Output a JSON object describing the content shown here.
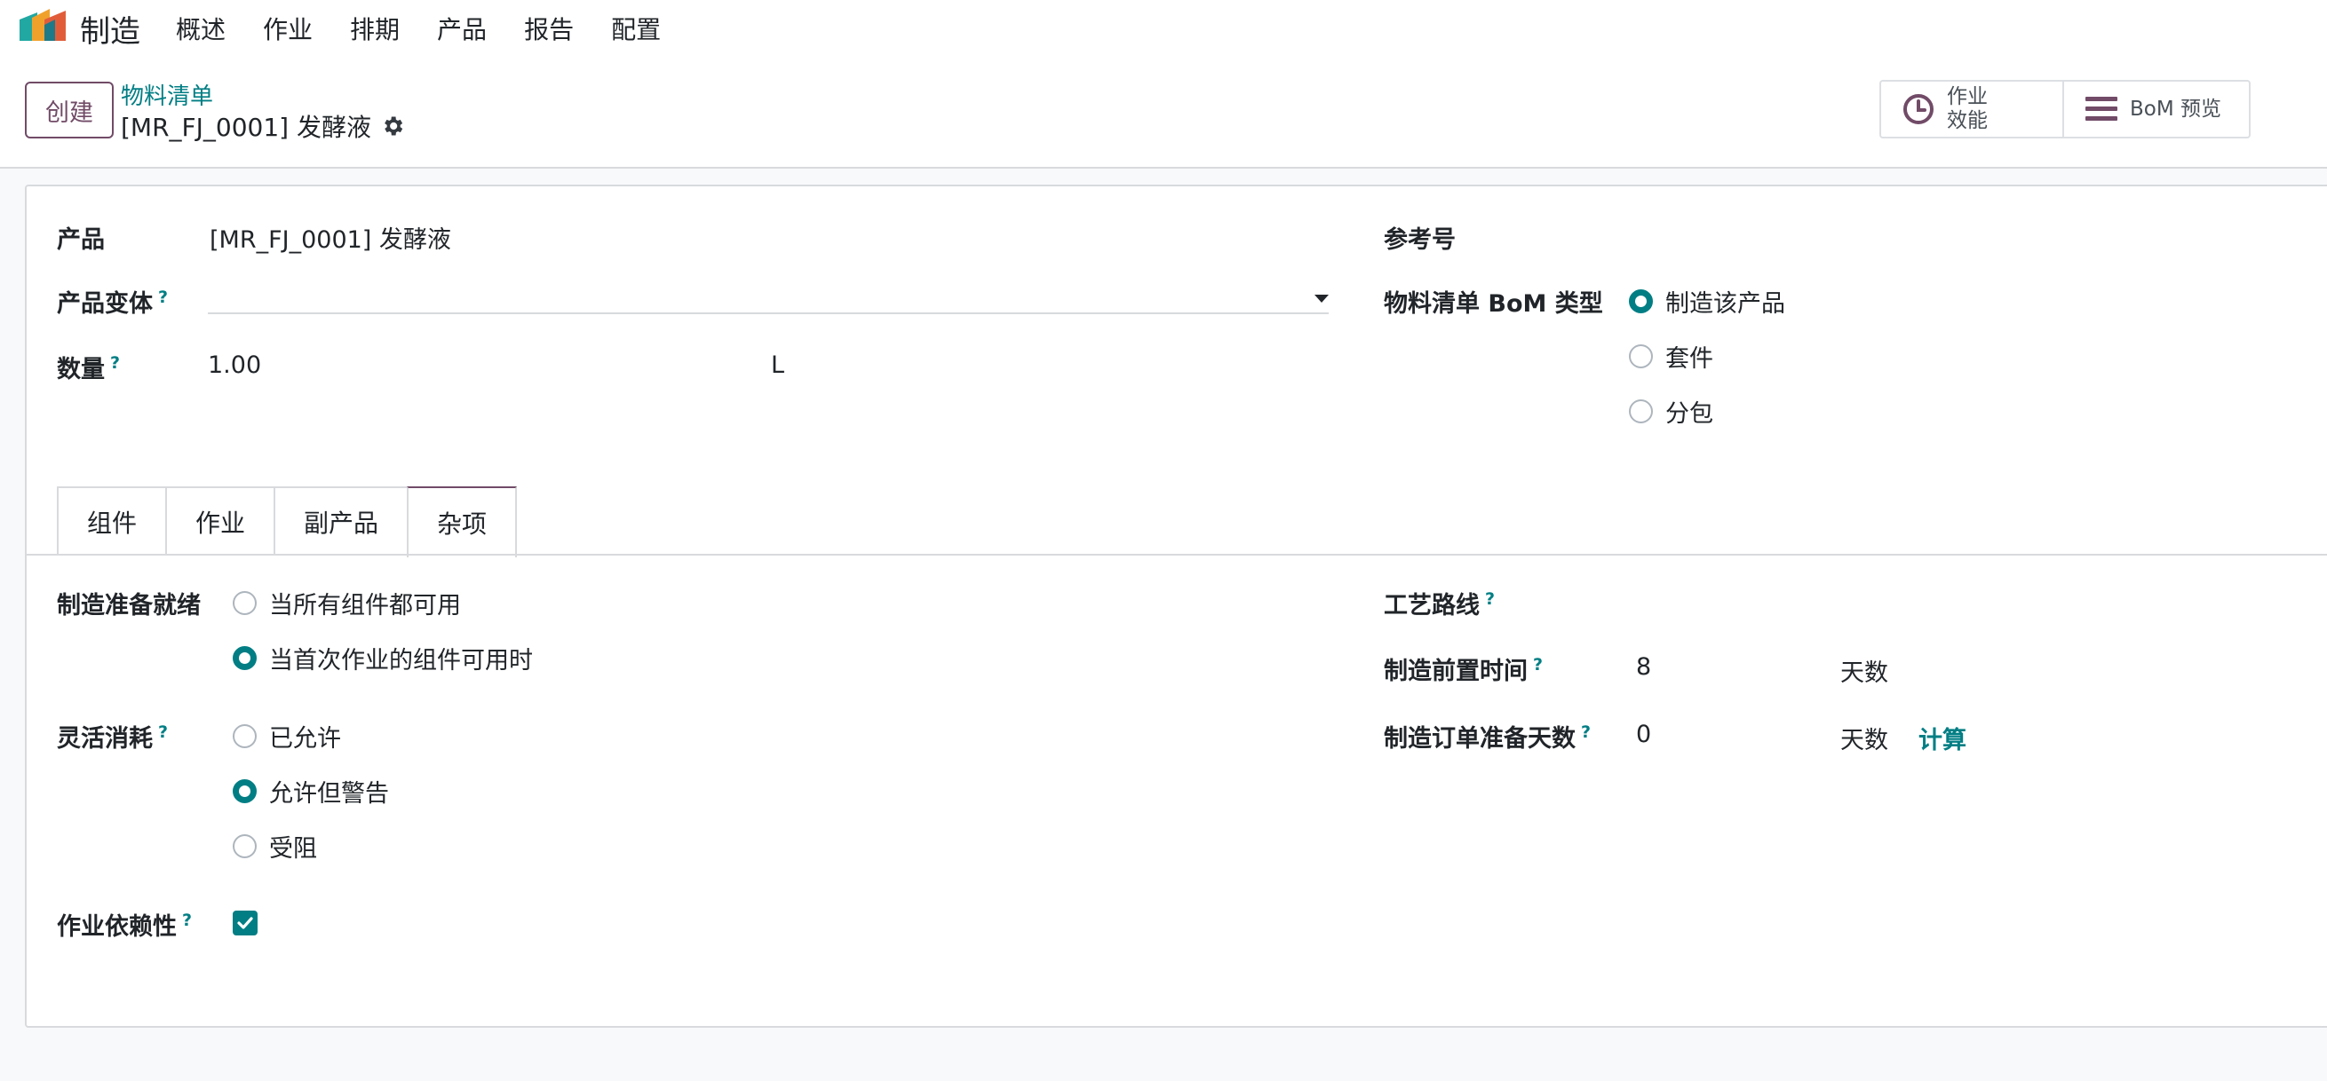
{
  "app": {
    "name": "制造"
  },
  "menu": [
    "概述",
    "作业",
    "排期",
    "产品",
    "报告",
    "配置"
  ],
  "control": {
    "create_label": "创建",
    "breadcrumb": "物料清单",
    "record_title": "[MR_FJ_0001] 发酵液",
    "smart_buttons": {
      "efficiency_line1": "作业",
      "efficiency_line2": "效能",
      "bom_preview": "BoM 预览"
    }
  },
  "form": {
    "product_label": "产品",
    "product_value": "[MR_FJ_0001] 发酵液",
    "variant_label": "产品变体",
    "variant_value": "",
    "quantity_label": "数量",
    "quantity_value": "1.00",
    "quantity_uom": "L",
    "reference_label": "参考号",
    "reference_value": "",
    "bom_type_label": "物料清单 BoM 类型",
    "bom_type_options": [
      {
        "label": "制造该产品",
        "selected": true
      },
      {
        "label": "套件",
        "selected": false
      },
      {
        "label": "分包",
        "selected": false
      }
    ],
    "help_mark": "?"
  },
  "tabs": [
    {
      "label": "组件",
      "active": false
    },
    {
      "label": "作业",
      "active": false
    },
    {
      "label": "副产品",
      "active": false
    },
    {
      "label": "杂项",
      "active": true
    }
  ],
  "misc": {
    "ready_label": "制造准备就绪",
    "ready_options": [
      {
        "label": "当所有组件都可用",
        "selected": false
      },
      {
        "label": "当首次作业的组件可用时",
        "selected": true
      }
    ],
    "flex_label": "灵活消耗",
    "flex_options": [
      {
        "label": "已允许",
        "selected": false
      },
      {
        "label": "允许但警告",
        "selected": true
      },
      {
        "label": "受阻",
        "selected": false
      }
    ],
    "dependency_label": "作业依赖性",
    "dependency_checked": true,
    "routing_label": "工艺路线",
    "lead_time_label": "制造前置时间",
    "lead_time_value": "8",
    "lead_time_unit": "天数",
    "prep_days_label": "制造订单准备天数",
    "prep_days_value": "0",
    "prep_days_unit": "天数",
    "compute_label": "计算"
  },
  "colors": {
    "brand": "#714b67",
    "accent": "#017e84",
    "border": "#d8dadd",
    "background": "#f8f9fb"
  }
}
